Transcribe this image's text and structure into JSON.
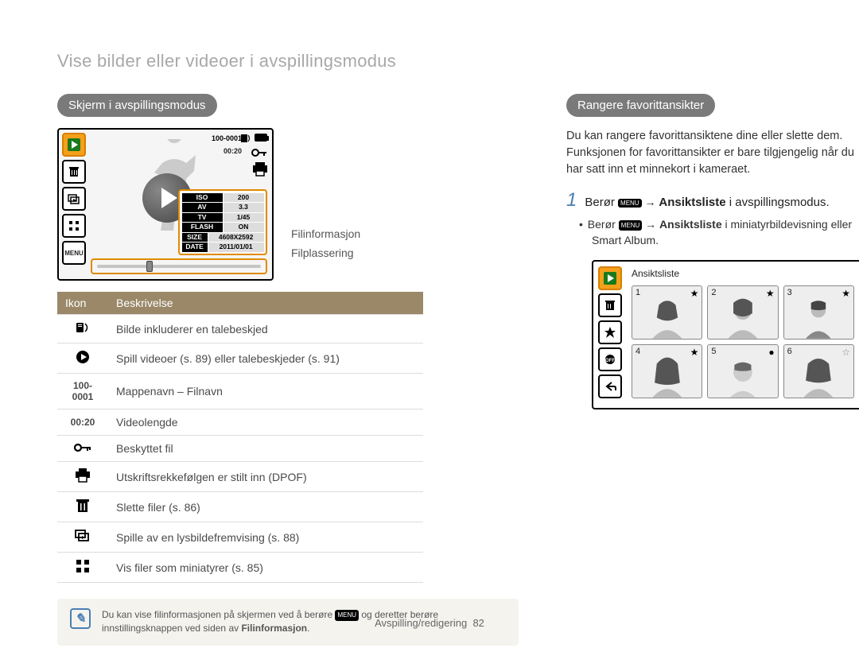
{
  "page_title": "Vise bilder eller videoer i avspillingsmodus",
  "footer": {
    "section": "Avspilling/redigering",
    "page": "82"
  },
  "left": {
    "heading": "Skjerm i avspillingsmodus",
    "screen": {
      "filename": "100-0001",
      "duration": "00:20",
      "menu_label": "MENU",
      "info": {
        "rows": [
          {
            "label": "ISO",
            "value": "200"
          },
          {
            "label": "AV",
            "value": "3.3"
          },
          {
            "label": "TV",
            "value": "1/45"
          }
        ],
        "flash_label": "FLASH",
        "flash_value": "ON",
        "size_label": "SIZE",
        "size_value": "4608X2592",
        "date_label": "DATE",
        "date_value": "2011/01/01"
      }
    },
    "callout_fileinfo": "Filinformasjon",
    "callout_filepos": "Filplassering",
    "table": {
      "header_icon": "Ikon",
      "header_desc": "Beskrivelse",
      "rows": [
        {
          "icon": "voice-memo-icon",
          "text_icon": "",
          "desc": "Bilde inkluderer en talebeskjed"
        },
        {
          "icon": "play-round-icon",
          "text_icon": "",
          "desc": "Spill videoer (s. 89) eller talebeskjeder (s. 91)"
        },
        {
          "icon": "",
          "text_icon": "100-0001",
          "desc": "Mappenavn – Filnavn"
        },
        {
          "icon": "",
          "text_icon": "00:20",
          "desc": "Videolengde"
        },
        {
          "icon": "key-icon",
          "text_icon": "",
          "desc": "Beskyttet fil"
        },
        {
          "icon": "printer-icon",
          "text_icon": "",
          "desc": "Utskriftsrekkefølgen er stilt inn (DPOF)"
        },
        {
          "icon": "trash-icon",
          "text_icon": "",
          "desc": "Slette filer (s. 86)"
        },
        {
          "icon": "slideshow-icon",
          "text_icon": "",
          "desc": "Spille av en lysbildefremvising (s. 88)"
        },
        {
          "icon": "thumbnails-icon",
          "text_icon": "",
          "desc": "Vis filer som miniatyrer (s. 85)"
        }
      ]
    },
    "note": {
      "pre": "Du kan vise filinformasjonen på skjermen ved å berøre ",
      "menu": "MENU",
      "mid": " og deretter berøre innstillingsknappen ved siden av ",
      "bold": "Filinformasjon",
      "post": "."
    }
  },
  "right": {
    "heading": "Rangere favorittansikter",
    "intro": "Du kan rangere favorittansiktene dine eller slette dem. Funksjonen for favorittansikter er bare tilgjengelig når du har satt inn et minnekort i kameraet.",
    "step1": {
      "num": "1",
      "pre": "Berør ",
      "menu": "MENU",
      "arrow": " → ",
      "bold": "Ansiktsliste",
      "post": " i avspillingsmodus."
    },
    "sub": {
      "pre": "Berør ",
      "menu": "MENU",
      "arrow": " → ",
      "bold": "Ansiktsliste",
      "post": " i miniatyrbildevisning eller Smart Album."
    },
    "face_screen": {
      "title": "Ansiktsliste",
      "ranks": [
        "1",
        "2",
        "3",
        "4",
        "5",
        "6"
      ],
      "star_filled": [
        true,
        true,
        true,
        true,
        false,
        false
      ]
    }
  }
}
